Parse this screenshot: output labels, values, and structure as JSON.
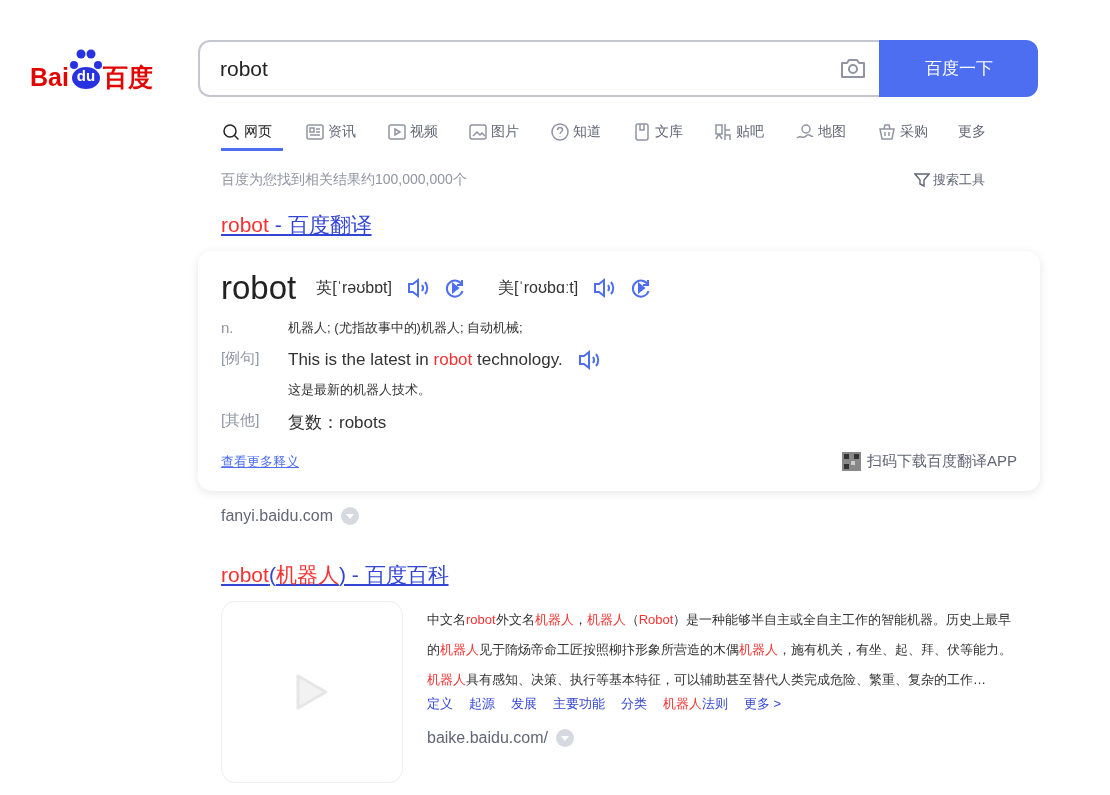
{
  "logo": {
    "latin": "Bai",
    "paw": "du",
    "chinese": "百度"
  },
  "search": {
    "value": "robot",
    "button": "百度一下"
  },
  "tabs": [
    {
      "label": "网页",
      "selected": true
    },
    {
      "label": "资讯",
      "selected": false
    },
    {
      "label": "视频",
      "selected": false
    },
    {
      "label": "图片",
      "selected": false
    },
    {
      "label": "知道",
      "selected": false
    },
    {
      "label": "文库",
      "selected": false
    },
    {
      "label": "贴吧",
      "selected": false
    },
    {
      "label": "地图",
      "selected": false
    },
    {
      "label": "采购",
      "selected": false
    },
    {
      "label": "更多",
      "selected": false
    }
  ],
  "result_count": "百度为您找到相关结果约100,000,000个",
  "search_tools": "搜索工具",
  "results": [
    {
      "kind": "dictionary",
      "title_parts": [
        {
          "text": "robot",
          "hl": true
        },
        {
          "text": " - 百度翻译",
          "hl": false
        }
      ],
      "word": "robot",
      "pronunciations": [
        {
          "region": "英",
          "ipa": "[ˈrəʊbɒt]"
        },
        {
          "region": "美",
          "ipa": "[ˈroʊbɑːt]"
        }
      ],
      "definitions": [
        {
          "label": "n.",
          "parts": [
            {
              "text": "机器人; (尤指故事中的)机器人; 自动机械;",
              "hl": false
            }
          ],
          "audio": false
        },
        {
          "label": "[例句]",
          "parts": [
            {
              "text": "This is the latest in ",
              "hl": false
            },
            {
              "text": "robot",
              "hl": true
            },
            {
              "text": " technology.",
              "hl": false
            }
          ],
          "translation": "这是最新的机器人技术。",
          "audio": true
        },
        {
          "label": "[其他]",
          "parts": [
            {
              "text": "复数：robots",
              "hl": false
            }
          ],
          "audio": false
        }
      ],
      "more_link": "查看更多释义",
      "app_promo": "扫码下载百度翻译APP",
      "url": "fanyi.baidu.com"
    },
    {
      "kind": "encyclopedia",
      "title_parts": [
        {
          "text": "robot",
          "hl": true
        },
        {
          "text": "(",
          "hl": false
        },
        {
          "text": "机器人",
          "hl": true
        },
        {
          "text": ") - 百度百科",
          "hl": false
        }
      ],
      "description": [
        {
          "text": "中文名",
          "hl": false
        },
        {
          "text": "robot",
          "hl": true
        },
        {
          "text": "外文名",
          "hl": false
        },
        {
          "text": "机器人",
          "hl": true
        },
        {
          "text": "，",
          "hl": false
        },
        {
          "text": "机器人",
          "hl": true
        },
        {
          "text": "（",
          "hl": false
        },
        {
          "text": "Robot",
          "hl": true
        },
        {
          "text": "）是一种能够半自主或全自主工作的智能机器。历史上最早的",
          "hl": false
        },
        {
          "text": "机器人",
          "hl": true
        },
        {
          "text": "见于隋炀帝命工匠按照柳抃形象所营造的木偶",
          "hl": false
        },
        {
          "text": "机器人",
          "hl": true
        },
        {
          "text": "，施有机关，有坐、起、拜、伏等能力。",
          "hl": false
        },
        {
          "text": "机器人",
          "hl": true
        },
        {
          "text": "具有感知、决策、执行等基本特征，可以辅助甚至替代人类完成危险、繁重、复杂的工作…",
          "hl": false
        }
      ],
      "sublinks": [
        {
          "parts": [
            {
              "text": "定义",
              "hl": false
            }
          ]
        },
        {
          "parts": [
            {
              "text": "起源",
              "hl": false
            }
          ]
        },
        {
          "parts": [
            {
              "text": "发展",
              "hl": false
            }
          ]
        },
        {
          "parts": [
            {
              "text": "主要功能",
              "hl": false
            }
          ]
        },
        {
          "parts": [
            {
              "text": "分类",
              "hl": false
            }
          ]
        },
        {
          "parts": [
            {
              "text": "机器人",
              "hl": true
            },
            {
              "text": "法则",
              "hl": false
            }
          ]
        },
        {
          "parts": [
            {
              "text": "更多 >",
              "hl": false
            }
          ]
        }
      ],
      "url": "baike.baidu.com/"
    }
  ]
}
